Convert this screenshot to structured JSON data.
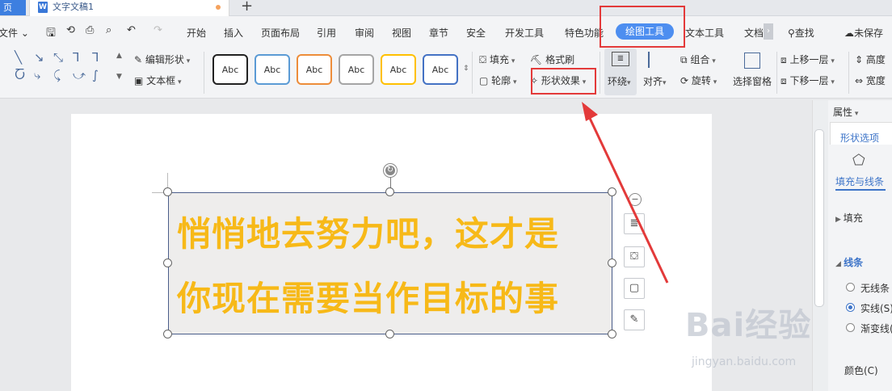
{
  "tabs": {
    "home": "页",
    "doc_title": "文字文稿1",
    "doc_icon": "W",
    "new_tab": "+"
  },
  "menu": {
    "file": "文件",
    "items": [
      "开始",
      "插入",
      "页面布局",
      "引用",
      "审阅",
      "视图",
      "章节",
      "安全",
      "开发工具",
      "特色功能"
    ],
    "active": "绘图工具",
    "after_active": [
      "文本工具",
      "文档"
    ],
    "search": "查找",
    "save_state": "未保存"
  },
  "ribbon": {
    "edit_shape": "编辑形状",
    "text_box": "文本框",
    "styles": [
      "Abc",
      "Abc",
      "Abc",
      "Abc",
      "Abc",
      "Abc"
    ],
    "style_colors": [
      "#222222",
      "#5b9bd5",
      "#ed8d3a",
      "#a5a5a5",
      "#ffc000",
      "#4472c4"
    ],
    "fill": "填充",
    "format_brush": "格式刷",
    "outline": "轮廓",
    "shape_effect": "形状效果",
    "wrap": "环绕",
    "align": "对齐",
    "group": "组合",
    "rotate": "旋转",
    "selection_pane": "选择窗格",
    "bring_forward": "上移一层",
    "send_backward": "下移一层",
    "height": "高度",
    "width": "宽度"
  },
  "canvas": {
    "line1": "悄悄地去努力吧，这才是",
    "line2": "你现在需要当作目标的事",
    "text_color": "#f7b918"
  },
  "panel": {
    "properties": "属性",
    "shape_options": "形状选项",
    "fill_line": "填充与线条",
    "fill": "填充",
    "line": "线条",
    "no_line": "无线条",
    "solid_line": "实线(S)",
    "gradient_line": "渐变线(",
    "color": "颜色(C)"
  },
  "watermark": {
    "brand": "Bai经验",
    "url": "jingyan.baidu.com"
  },
  "colors": {
    "accent": "#4d8ef0",
    "highlight": "#e33a3a"
  }
}
